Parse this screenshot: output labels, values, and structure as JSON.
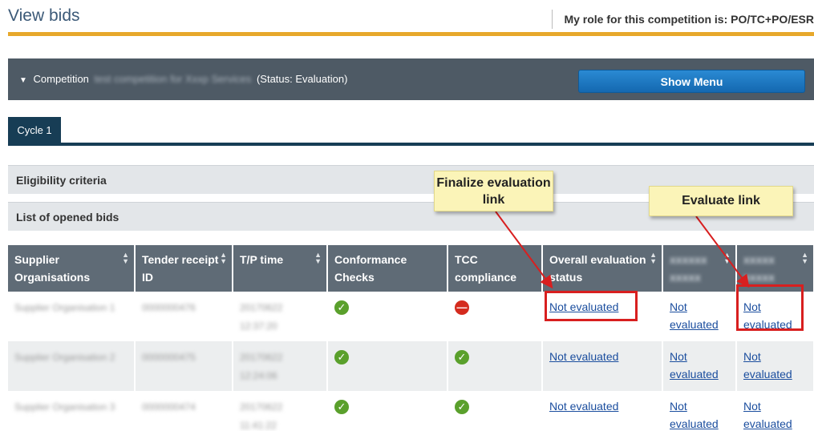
{
  "header": {
    "title": "View bids",
    "role_text": "My role for this competition is: PO/TC+PO/ESR"
  },
  "competition": {
    "prefix": "Competition",
    "name_redacted": "test competition for Xxxp Services",
    "status": "(Status: Evaluation)",
    "show_menu_label": "Show Menu"
  },
  "tabs": [
    {
      "label": "Cycle 1"
    }
  ],
  "sections": {
    "eligibility": "Eligibility criteria",
    "opened_bids": "List of opened bids"
  },
  "table": {
    "headers": [
      "Supplier Organisations",
      "Tender receipt ID",
      "T/P time",
      "Conformance Checks",
      "TCC compliance",
      "Overall evaluation status",
      "xxxxxx xxxxx",
      "xxxxx xxxxx"
    ],
    "rows": [
      {
        "supplier": "Supplier Organisation 1",
        "receipt_id": "0000000476",
        "tp_time": "20170622 12:37:20",
        "conformance": "check",
        "tcc": "fail",
        "overall": "Not evaluated",
        "col7": "Not evaluated",
        "col8": "Not evaluated"
      },
      {
        "supplier": "Supplier Organisation 2",
        "receipt_id": "0000000475",
        "tp_time": "20170622 12:24:06",
        "conformance": "check",
        "tcc": "check",
        "overall": "Not evaluated",
        "col7": "Not evaluated",
        "col8": "Not evaluated"
      },
      {
        "supplier": "Supplier Organisation 3",
        "receipt_id": "0000000474",
        "tp_time": "20170622 11:41:22",
        "conformance": "check",
        "tcc": "check",
        "overall": "Not evaluated",
        "col7": "Not evaluated",
        "col8": "Not evaluated"
      }
    ]
  },
  "annotations": {
    "finalize": "Finalize evaluation link",
    "evaluate": "Evaluate link",
    "box_color": "#d81f1f"
  },
  "colors": {
    "accent_gold": "#e7a82b",
    "header_bar": "#4e5a65",
    "tab_blue": "#173d55",
    "button_blue": "#1f7cc4",
    "check_green": "#5aa02c",
    "fail_red": "#d42b1e"
  }
}
